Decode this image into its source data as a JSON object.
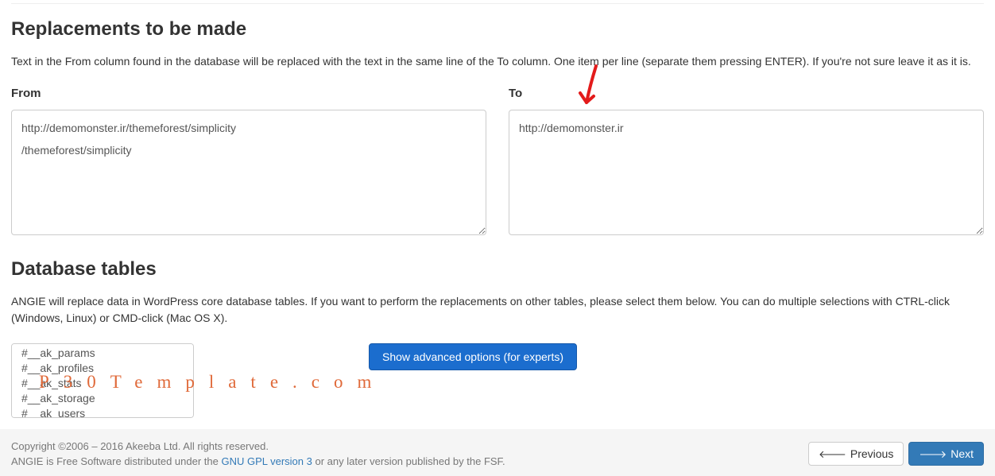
{
  "section1": {
    "heading": "Replacements to be made",
    "description": "Text in the From column found in the database will be replaced with the text in the same line of the To column. One item per line (separate them pressing ENTER). If you're not sure leave it as it is.",
    "from_label": "From",
    "to_label": "To",
    "from_value": "http://demomonster.ir/themeforest/simplicity\n/themeforest/simplicity",
    "to_value": "http://demomonster.ir"
  },
  "section2": {
    "heading": "Database tables",
    "description": "ANGIE will replace data in WordPress core database tables. If you want to perform the replacements on other tables, please select them below. You can do multiple selections with CTRL-click (Windows, Linux) or CMD-click (Mac OS X).",
    "tables": [
      "#__ak_params",
      "#__ak_profiles",
      "#__ak_stats",
      "#__ak_storage",
      "#__ak_users"
    ],
    "advanced_button": "Show advanced options (for experts)"
  },
  "watermark": "P30Template.com",
  "footer": {
    "line1": "Copyright ©2006 – 2016 Akeeba Ltd. All rights reserved.",
    "line2_a": "ANGIE is Free Software distributed under the ",
    "line2_link": "GNU GPL version 3",
    "line2_b": " or any later version published by the FSF.",
    "prev_label": "Previous",
    "next_label": "Next"
  }
}
